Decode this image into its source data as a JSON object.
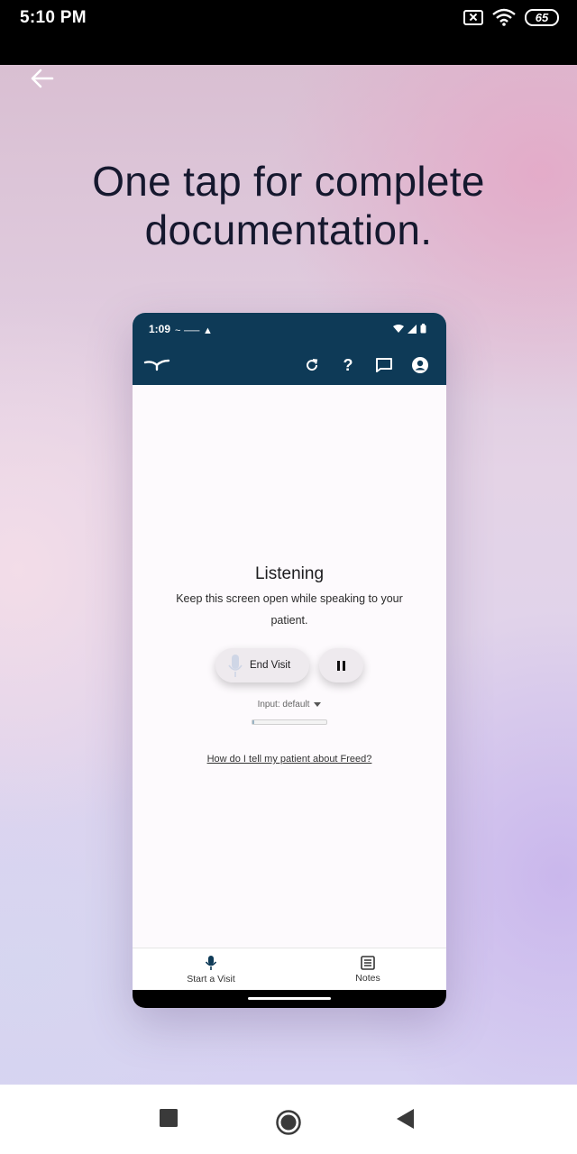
{
  "status_bar": {
    "time": "5:10 PM",
    "battery": "65"
  },
  "headline": {
    "line1": "One tap for complete",
    "line2": "documentation."
  },
  "phone": {
    "status_time": "1:09",
    "screen": {
      "title": "Listening",
      "description": "Keep this screen open while speaking to your patient.",
      "end_visit_label": "End Visit",
      "input_label": "Input: default",
      "help_link": "How do I tell my patient about Freed?"
    },
    "nav": {
      "start_visit_label": "Start a Visit",
      "notes_label": "Notes"
    }
  },
  "colors": {
    "app_bar": "#0e3a57",
    "headline": "#15182e"
  },
  "icons": [
    "back-arrow-icon",
    "refresh-icon",
    "help-icon",
    "chat-icon",
    "account-icon",
    "microphone-icon",
    "pause-icon",
    "notes-icon",
    "wifi-icon",
    "sim-off-icon",
    "battery-icon"
  ]
}
